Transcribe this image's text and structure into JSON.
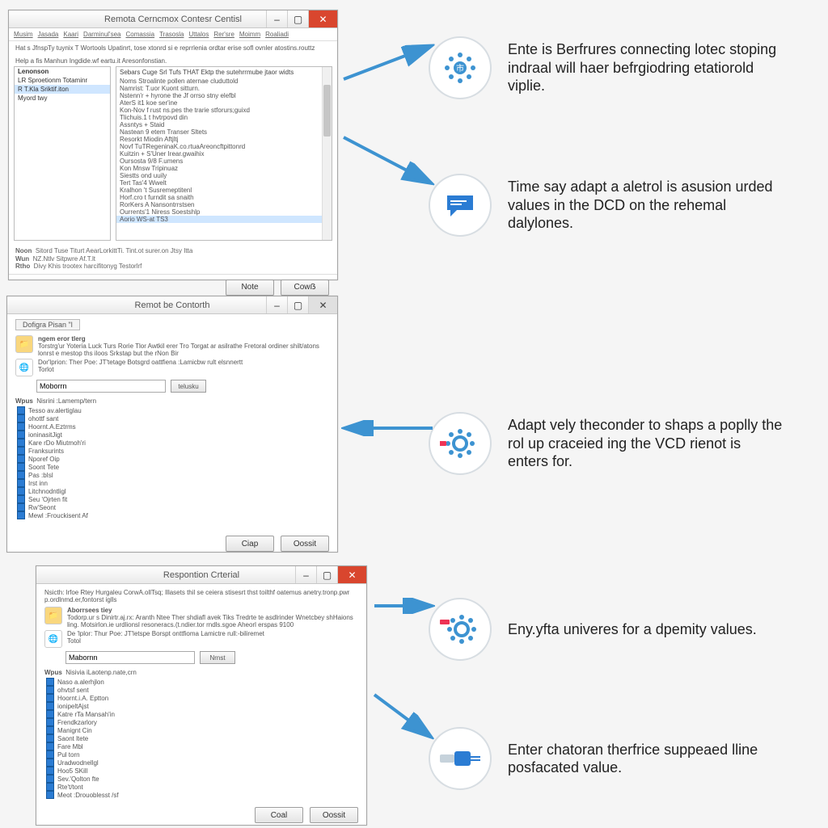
{
  "windows": {
    "w1": {
      "title": "Remota Cerncmox Contesr Centisl",
      "tabs": [
        "Musim",
        "Jasada",
        "Kaari",
        "Darminul'sea",
        "Comassia",
        "Trasosla",
        "Uttalos",
        "Rer'sre",
        "Moimm",
        "Roaliadi"
      ],
      "desc1": "Hat s JfnspTy tuynix T Wortools Upatinrt, tose xtonrd si e reprrlenia ordtar erise sofl ovnler atostins.routtz",
      "desc2": "Help a fis Manhun Ingdide.wf eartu.it Aresonfonstian.",
      "left": [
        {
          "label": "Lenonson",
          "bold": true,
          "sel": false
        },
        {
          "label": "LR Sproetionm Totaminr",
          "bold": false,
          "sel": false
        },
        {
          "label": "R T.Kla Sriktif.iton",
          "bold": false,
          "sel": true
        },
        {
          "label": "Myord twy",
          "bold": false,
          "sel": false
        }
      ],
      "right_header": "Sebars Cuge Srl Tufs THAT Ektp the sutehrrmube jtaor widts",
      "right": [
        "Noms Stroalinte pollen aternae cluduttold",
        "Namrist: T.uor Kuont sitturn.",
        "Nstenn'r + hyrone the Jf orrso stny elefbl",
        "AterS it1 koe ser'ine",
        "Kon-Nov f rust ns.pes the trarie stforurs;guixd",
        "Tlichuis.1 t hvtrpovd din",
        "Assntys + Staid",
        "Nastean 9 etem Transer Sltets",
        "Resorkt Miodin Aftjltj",
        "Novf TuTRegeninaK.co.rtuaAreoncftpittonrd",
        "Kuitzin + S'Uner Irear.gwaihix",
        "Oursosta 9/8 F.umens",
        "Kon Mnsw Tripinuaz",
        "Siestts ond uuily",
        "Tert Tas'4 Wwelt",
        "Kralhon 't Susremeptitenl",
        "Horf.cro t furndit sa snaith",
        "RorKers A Nansontrrstsen",
        "Ourrents'1 Niress Soestshlp"
      ],
      "right_selected": "Aorio WS-at TS3",
      "foot": [
        "Sitord Tuse Titurt AearLorkittTi. Tint.ot surer.on Jtsy Itta",
        "NZ.Ntlv Sitpwre Af.T.lt",
        "Divy Khis trootex harcifitonyg Testorlrf"
      ],
      "foot_labels": [
        "Noon",
        "Wun",
        "Rtho"
      ],
      "btn_ok": "Note",
      "btn_cancel": "Cowẞ"
    },
    "w2": {
      "title": "Remot be Contorth",
      "tab": "Dofigra Pisan \"l",
      "hdr_label": "ngem eror tlerg",
      "desc": "Torstrg'ur Yoteria Luck Turs Rorie Tlor Awtkil erer Tro Torgat ar asilrathe Fretoral ordiner shilt/atons lonrst e mestop ths iloos Srkstap but the rNon Bir",
      "desc2": "Dor'lprion: Ther Poe: JT'tetage Botsgrd oattfiena :Lamicbw rult elsnnertt",
      "desc_label": "Torlot",
      "input_value": "Moborrn",
      "input_btn": "telusku",
      "list_label": "Nisrini :Lamemp/tern",
      "list": [
        "Tesso av.alertiglau",
        "ohottf sant",
        "Hoornt.A.Eztrms",
        "ioninasitJigt",
        "Kare rDo Miutmoh'ri",
        "Franksurints",
        "Nporef Oip",
        "Soont Tete",
        "Pas :bIsl",
        "Irst inn",
        "Litchnodntligl",
        "Seu 'Ojrten fit",
        "Rw'Seont",
        "Mewl :Frouckisent Af"
      ],
      "btn_ok": "Ciap",
      "btn_cancel": "Oossit"
    },
    "w3": {
      "title": "Respontion Crterial",
      "top_desc": "Nsicth: lrfoe Rtey Hurgaleu CorwA.ollTsq; Illasets thil se ceiera stisesrt thst toilthf oatemus anetry.tronp.pwr p.ordlnmd.er,fontorst iglls",
      "hdr_label": "Aborrsees tiey",
      "desc": "Todorp.ur s Dinirtr.aj.rx: Aranth Ntee Ther shdiafl avek Tiks Tredrte te asdlrinder Wnetcbey shHaions ling. Motsirlon.ie urdlionsl resoneracs.(t.ndier.tor rndls.sgoe Aheorl erspas 9100",
      "desc2": "De 'lplor: Thur Poe: JT'letspe Borspt onttfioma Lamictre rull:-biliremet",
      "desc_label": "Totol",
      "input_value": "Mabornn",
      "input_btn": "Nrnst",
      "list_label": "Nisivia iLaotenp.nate,crn",
      "list": [
        "Naso a.alerhjlon",
        "ohvtsf sent",
        "Hoornt.i.A. Eptton",
        "ionipeltAjst",
        "Katre rTa Mansah'in",
        "Frendkzarlory",
        "Manignt Cin",
        "Saont ltete",
        "Fare Mbl",
        "Pul torn",
        "Uradwodnellgl",
        "Hoo5 SKill",
        "Sev.'Qolton fte",
        "Rte't/tont",
        "Meot :Drouoblesst /sf"
      ],
      "btn_ok": "Coal",
      "btn_cancel": "Oossit"
    }
  },
  "features": [
    {
      "icon": "snow",
      "text": "Ente is Berfrures connecting lotec stoping indraal will haer befrgiodring etatiorold viplie."
    },
    {
      "icon": "chat",
      "text": "Time say adapt a aletrol is asusion urded values in the DCD on the rehemal dalylones."
    },
    {
      "icon": "gear-dots",
      "text": "Adapt vely theconder to shaps a poplly the rol up craceied ing the VCD rienot is enters for."
    },
    {
      "icon": "gear-dots",
      "text": "Eny.yfta univeres for a dpemity values."
    },
    {
      "icon": "plug",
      "text": "Enter chatoran therfrice suppeaed lline posfacated value."
    }
  ]
}
